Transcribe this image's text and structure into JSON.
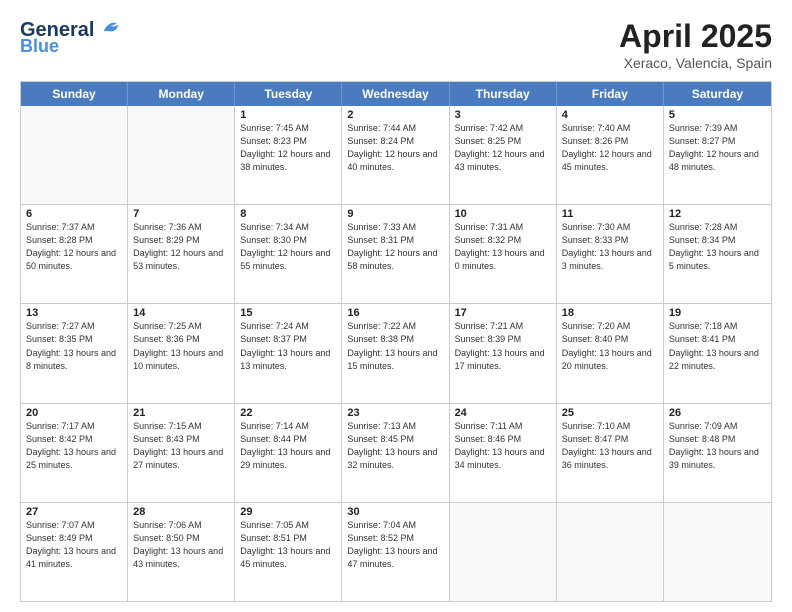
{
  "header": {
    "logo_line1": "General",
    "logo_line2": "Blue",
    "title": "April 2025",
    "subtitle": "Xeraco, Valencia, Spain"
  },
  "days_of_week": [
    "Sunday",
    "Monday",
    "Tuesday",
    "Wednesday",
    "Thursday",
    "Friday",
    "Saturday"
  ],
  "weeks": [
    [
      {
        "day": "",
        "sun": "",
        "set": "",
        "dl": ""
      },
      {
        "day": "",
        "sun": "",
        "set": "",
        "dl": ""
      },
      {
        "day": "1",
        "sun": "Sunrise: 7:45 AM",
        "set": "Sunset: 8:23 PM",
        "dl": "Daylight: 12 hours and 38 minutes."
      },
      {
        "day": "2",
        "sun": "Sunrise: 7:44 AM",
        "set": "Sunset: 8:24 PM",
        "dl": "Daylight: 12 hours and 40 minutes."
      },
      {
        "day": "3",
        "sun": "Sunrise: 7:42 AM",
        "set": "Sunset: 8:25 PM",
        "dl": "Daylight: 12 hours and 43 minutes."
      },
      {
        "day": "4",
        "sun": "Sunrise: 7:40 AM",
        "set": "Sunset: 8:26 PM",
        "dl": "Daylight: 12 hours and 45 minutes."
      },
      {
        "day": "5",
        "sun": "Sunrise: 7:39 AM",
        "set": "Sunset: 8:27 PM",
        "dl": "Daylight: 12 hours and 48 minutes."
      }
    ],
    [
      {
        "day": "6",
        "sun": "Sunrise: 7:37 AM",
        "set": "Sunset: 8:28 PM",
        "dl": "Daylight: 12 hours and 50 minutes."
      },
      {
        "day": "7",
        "sun": "Sunrise: 7:36 AM",
        "set": "Sunset: 8:29 PM",
        "dl": "Daylight: 12 hours and 53 minutes."
      },
      {
        "day": "8",
        "sun": "Sunrise: 7:34 AM",
        "set": "Sunset: 8:30 PM",
        "dl": "Daylight: 12 hours and 55 minutes."
      },
      {
        "day": "9",
        "sun": "Sunrise: 7:33 AM",
        "set": "Sunset: 8:31 PM",
        "dl": "Daylight: 12 hours and 58 minutes."
      },
      {
        "day": "10",
        "sun": "Sunrise: 7:31 AM",
        "set": "Sunset: 8:32 PM",
        "dl": "Daylight: 13 hours and 0 minutes."
      },
      {
        "day": "11",
        "sun": "Sunrise: 7:30 AM",
        "set": "Sunset: 8:33 PM",
        "dl": "Daylight: 13 hours and 3 minutes."
      },
      {
        "day": "12",
        "sun": "Sunrise: 7:28 AM",
        "set": "Sunset: 8:34 PM",
        "dl": "Daylight: 13 hours and 5 minutes."
      }
    ],
    [
      {
        "day": "13",
        "sun": "Sunrise: 7:27 AM",
        "set": "Sunset: 8:35 PM",
        "dl": "Daylight: 13 hours and 8 minutes."
      },
      {
        "day": "14",
        "sun": "Sunrise: 7:25 AM",
        "set": "Sunset: 8:36 PM",
        "dl": "Daylight: 13 hours and 10 minutes."
      },
      {
        "day": "15",
        "sun": "Sunrise: 7:24 AM",
        "set": "Sunset: 8:37 PM",
        "dl": "Daylight: 13 hours and 13 minutes."
      },
      {
        "day": "16",
        "sun": "Sunrise: 7:22 AM",
        "set": "Sunset: 8:38 PM",
        "dl": "Daylight: 13 hours and 15 minutes."
      },
      {
        "day": "17",
        "sun": "Sunrise: 7:21 AM",
        "set": "Sunset: 8:39 PM",
        "dl": "Daylight: 13 hours and 17 minutes."
      },
      {
        "day": "18",
        "sun": "Sunrise: 7:20 AM",
        "set": "Sunset: 8:40 PM",
        "dl": "Daylight: 13 hours and 20 minutes."
      },
      {
        "day": "19",
        "sun": "Sunrise: 7:18 AM",
        "set": "Sunset: 8:41 PM",
        "dl": "Daylight: 13 hours and 22 minutes."
      }
    ],
    [
      {
        "day": "20",
        "sun": "Sunrise: 7:17 AM",
        "set": "Sunset: 8:42 PM",
        "dl": "Daylight: 13 hours and 25 minutes."
      },
      {
        "day": "21",
        "sun": "Sunrise: 7:15 AM",
        "set": "Sunset: 8:43 PM",
        "dl": "Daylight: 13 hours and 27 minutes."
      },
      {
        "day": "22",
        "sun": "Sunrise: 7:14 AM",
        "set": "Sunset: 8:44 PM",
        "dl": "Daylight: 13 hours and 29 minutes."
      },
      {
        "day": "23",
        "sun": "Sunrise: 7:13 AM",
        "set": "Sunset: 8:45 PM",
        "dl": "Daylight: 13 hours and 32 minutes."
      },
      {
        "day": "24",
        "sun": "Sunrise: 7:11 AM",
        "set": "Sunset: 8:46 PM",
        "dl": "Daylight: 13 hours and 34 minutes."
      },
      {
        "day": "25",
        "sun": "Sunrise: 7:10 AM",
        "set": "Sunset: 8:47 PM",
        "dl": "Daylight: 13 hours and 36 minutes."
      },
      {
        "day": "26",
        "sun": "Sunrise: 7:09 AM",
        "set": "Sunset: 8:48 PM",
        "dl": "Daylight: 13 hours and 39 minutes."
      }
    ],
    [
      {
        "day": "27",
        "sun": "Sunrise: 7:07 AM",
        "set": "Sunset: 8:49 PM",
        "dl": "Daylight: 13 hours and 41 minutes."
      },
      {
        "day": "28",
        "sun": "Sunrise: 7:06 AM",
        "set": "Sunset: 8:50 PM",
        "dl": "Daylight: 13 hours and 43 minutes."
      },
      {
        "day": "29",
        "sun": "Sunrise: 7:05 AM",
        "set": "Sunset: 8:51 PM",
        "dl": "Daylight: 13 hours and 45 minutes."
      },
      {
        "day": "30",
        "sun": "Sunrise: 7:04 AM",
        "set": "Sunset: 8:52 PM",
        "dl": "Daylight: 13 hours and 47 minutes."
      },
      {
        "day": "",
        "sun": "",
        "set": "",
        "dl": ""
      },
      {
        "day": "",
        "sun": "",
        "set": "",
        "dl": ""
      },
      {
        "day": "",
        "sun": "",
        "set": "",
        "dl": ""
      }
    ]
  ]
}
